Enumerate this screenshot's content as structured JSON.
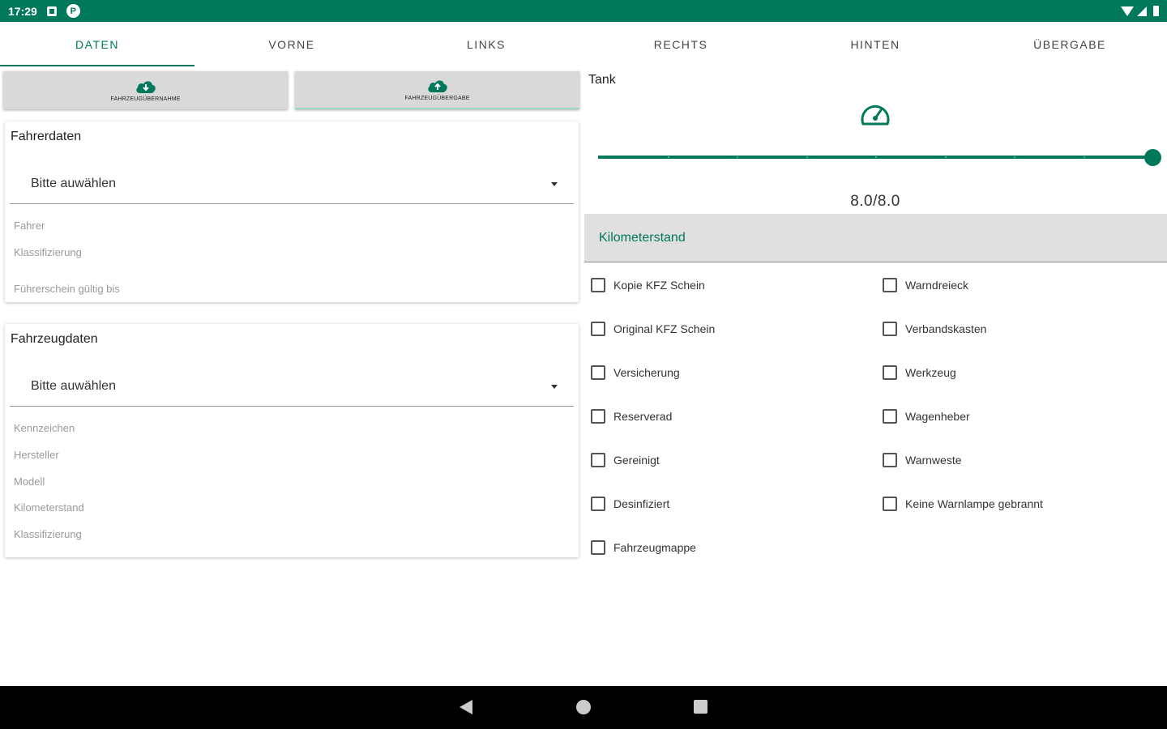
{
  "status_bar": {
    "time": "17:29",
    "notification_icon_letter": "P"
  },
  "tabs": [
    {
      "label": "DATEN",
      "active": true
    },
    {
      "label": "VORNE",
      "active": false
    },
    {
      "label": "LINKS",
      "active": false
    },
    {
      "label": "RECHTS",
      "active": false
    },
    {
      "label": "HINTEN",
      "active": false
    },
    {
      "label": "ÜBERGABE",
      "active": false
    }
  ],
  "actions": {
    "takeover": {
      "label": "FAHRZEUGÜBERNAHME",
      "icon": "cloud-download-icon"
    },
    "handover": {
      "label": "FAHRZEUGÜBERGABE",
      "icon": "cloud-upload-icon"
    }
  },
  "driver_card": {
    "title": "Fahrerdaten",
    "select_value": "Bitte auwählen",
    "fields": [
      "Fahrer",
      "Klassifizierung",
      "Führerschein gültig bis"
    ]
  },
  "vehicle_card": {
    "title": "Fahrzeugdaten",
    "select_value": "Bitte auwählen",
    "fields": [
      "Kennzeichen",
      "Hersteller",
      "Modell",
      "Kilometerstand",
      "Klassifizierung"
    ]
  },
  "tank": {
    "label": "Tank",
    "value_text": "8.0/8.0",
    "level_fraction": 1.0,
    "icon": "speedometer-icon"
  },
  "mileage_field": {
    "placeholder": "Kilometerstand"
  },
  "checklist": {
    "left": [
      "Kopie KFZ Schein",
      "Original KFZ Schein",
      "Versicherung",
      "Reserverad",
      "Gereinigt",
      "Desinfiziert",
      "Fahrzeugmappe"
    ],
    "right": [
      "Warndreieck",
      "Verbandskasten",
      "Werkzeug",
      "Wagenheber",
      "Warnweste",
      "Keine Warnlampe gebrannt"
    ]
  },
  "colors": {
    "primary": "#00785a",
    "button_bg": "#d9d9d9",
    "field_bg": "#e0e0e0"
  }
}
